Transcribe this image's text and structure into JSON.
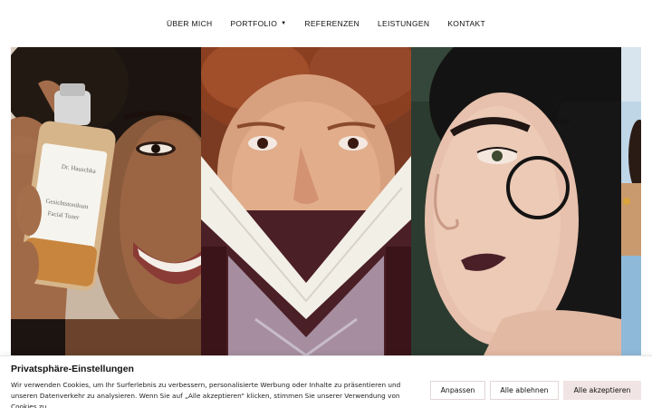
{
  "nav": {
    "items": [
      {
        "label": "ÜBER MICH"
      },
      {
        "label": "PORTFOLIO",
        "has_dropdown": true,
        "dropdown_icon": "chevron-down-icon"
      },
      {
        "label": "REFERENZEN"
      },
      {
        "label": "LEISTUNGEN"
      },
      {
        "label": "KONTAKT"
      }
    ]
  },
  "gallery": {
    "images": [
      {
        "name": "smiling-woman-with-serum-bottle",
        "bottle_text_1": "Dr. Hauschka",
        "bottle_text_2": "Gesichtstonikum",
        "bottle_text_3": "Facial Toner"
      },
      {
        "name": "redhead-freckles-sweater"
      },
      {
        "name": "woman-with-curl-dark-lips"
      },
      {
        "name": "partial-portrait-edge"
      }
    ]
  },
  "cookie_banner": {
    "title": "Privatsphäre-Einstellungen",
    "text": "Wir verwenden Cookies, um Ihr Surferlebnis zu verbessern, personalisierte Werbung oder Inhalte zu präsentieren und unseren Datenverkehr zu analysieren. Wenn Sie auf „Alle akzeptieren“ klicken, stimmen Sie unserer Verwendung von Cookies zu.",
    "buttons": {
      "customize": "Anpassen",
      "reject": "Alle ablehnen",
      "accept": "Alle akzeptieren"
    },
    "colors": {
      "accept_bg": "#f0e4e4",
      "border": "#e3d6d6"
    }
  }
}
